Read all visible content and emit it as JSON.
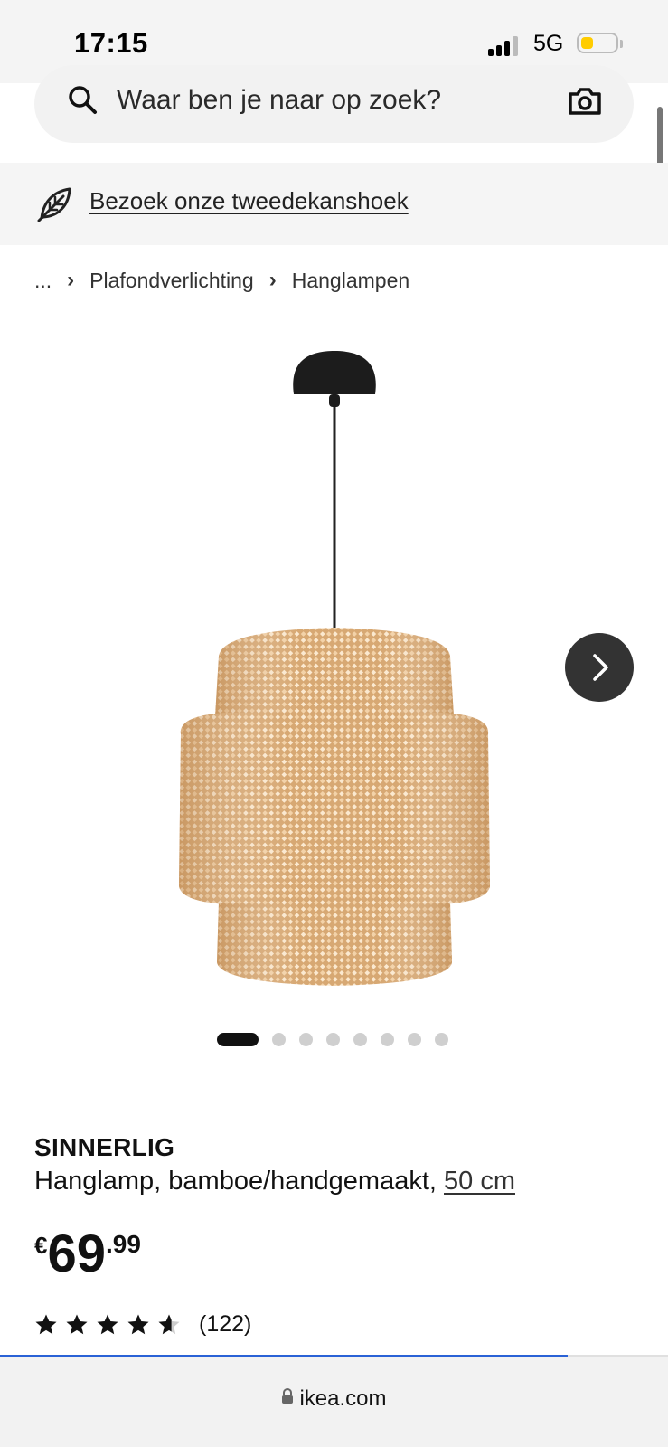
{
  "status_bar": {
    "time": "17:15",
    "network": "5G",
    "battery_level": 0.35,
    "battery_color": "#ffcc00"
  },
  "search": {
    "placeholder": "Waar ben je naar op zoek?",
    "icon": "search-icon",
    "camera_icon": "camera-icon"
  },
  "banner": {
    "icon": "leaf-icon",
    "link_text": "Bezoek onze tweedekanshoek"
  },
  "breadcrumb": {
    "items": [
      "...",
      "Plafondverlichting",
      "Hanglampen"
    ]
  },
  "gallery": {
    "next_icon": "chevron-right-icon",
    "image_count": 8,
    "active_index": 0
  },
  "product": {
    "name": "SINNERLIG",
    "description": "Hanglamp, bamboe/handgemaakt, ",
    "size": "50 cm",
    "price": {
      "currency": "€",
      "integer": "69",
      "decimal": ".99"
    },
    "rating": {
      "value": 4.6,
      "max": 5,
      "review_count": "(122)"
    }
  },
  "browser": {
    "url": "ikea.com",
    "load_progress": 0.85,
    "progress_color": "#2a62d6"
  }
}
